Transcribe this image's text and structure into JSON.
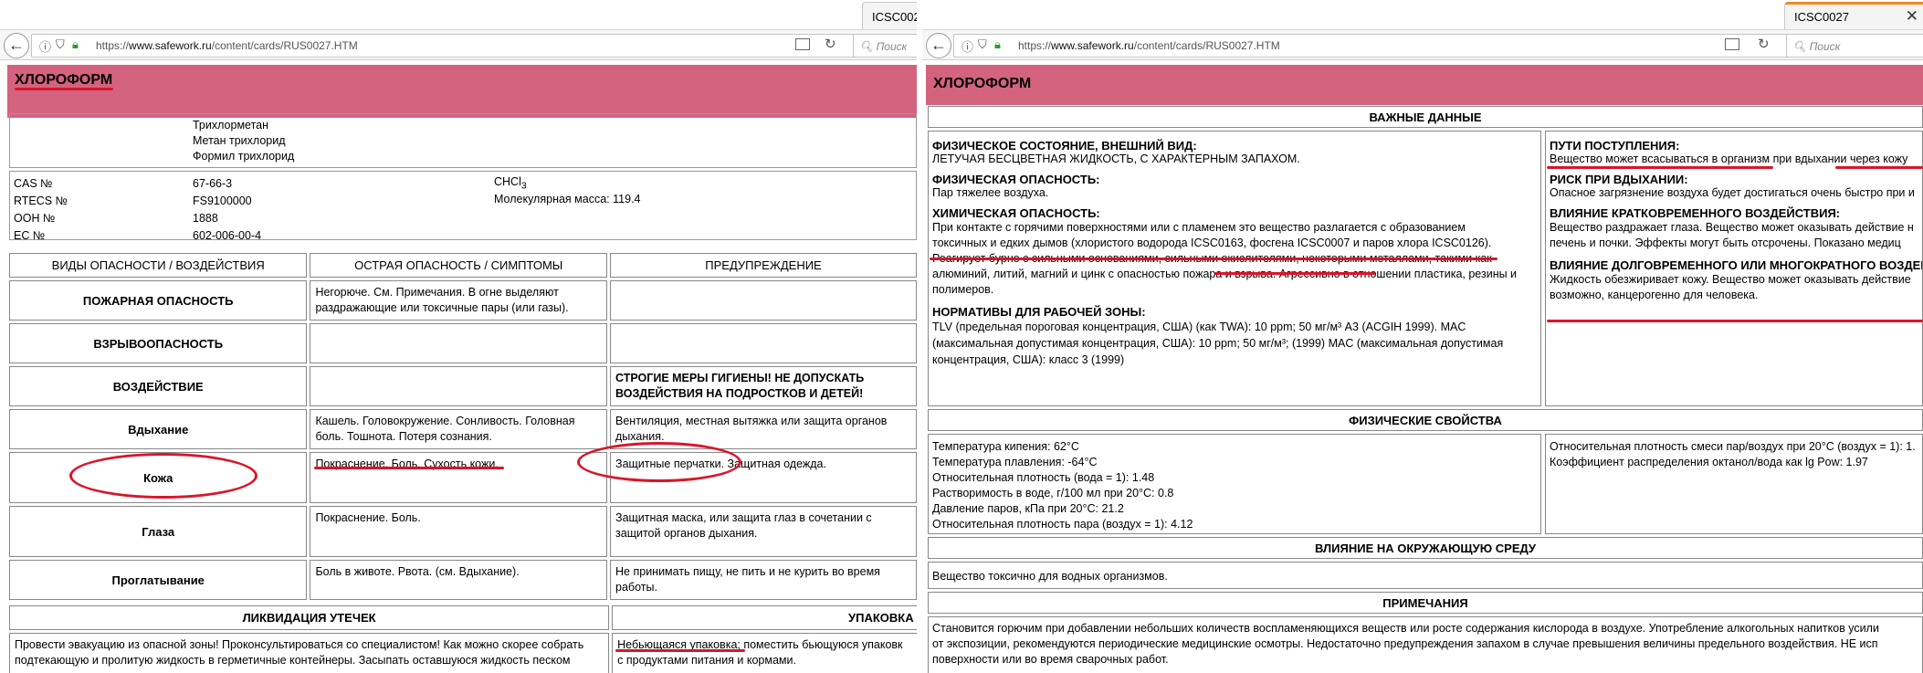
{
  "browser": {
    "tab_title": "ICSC0027",
    "url_host": "www.safework.ru",
    "url_scheme": "https://",
    "url_path": "/content/cards/RUS0027.HTM",
    "search_placeholder": "Поиск",
    "back_glyph": "←"
  },
  "card": {
    "title": "ХЛОРОФОРМ",
    "synonyms": [
      "Трихлорметан",
      "Метан трихлорид",
      "Формил трихлорид"
    ],
    "ids": [
      {
        "label": "CAS №",
        "value": "67-66-3"
      },
      {
        "label": "RTECS №",
        "value": "FS9100000"
      },
      {
        "label": "ООН №",
        "value": "1888"
      },
      {
        "label": "ЕС №",
        "value": "602-006-00-4"
      }
    ],
    "formula": "CHCl",
    "formula_sub": "3",
    "mol_mass_label": "Молекулярная масса:",
    "mol_mass_value": "119.4",
    "hazards_table": {
      "headers": [
        "ВИДЫ ОПАСНОСТИ / ВОЗДЕЙСТВИЯ",
        "ОСТРАЯ ОПАСНОСТЬ / СИМПТОМЫ",
        "ПРЕДУПРЕЖДЕНИЕ"
      ],
      "fire": {
        "label": "ПОЖАРНАЯ ОПАСНОСТЬ",
        "symptoms": "Негорюче. См. Примечания. В огне выделяют раздражающие или токсичные пары (или газы).",
        "prevention": ""
      },
      "explosion": {
        "label": "ВЗРЫВООПАСНОСТЬ",
        "symptoms": "",
        "prevention": ""
      },
      "exposure": {
        "label": "ВОЗДЕЙСТВИЕ",
        "symptoms": "",
        "prevention": "СТРОГИЕ МЕРЫ ГИГИЕНЫ! НЕ ДОПУСКАТЬ ВОЗДЕЙСТВИЯ НА ПОДРОСТКОВ И ДЕТЕЙ!"
      },
      "inhalation": {
        "label": "Вдыхание",
        "symptoms": "Кашель. Головокружение. Сонливость. Головная боль. Тошнота. Потеря сознания.",
        "prevention": "Вентиляция, местная вытяжка или защита органов дыхания."
      },
      "skin": {
        "label": "Кожа",
        "symptoms": "Покраснение. Боль. Сухость кожи.",
        "prevention": "Защитные перчатки. Защитная одежда."
      },
      "eyes": {
        "label": "Глаза",
        "symptoms": "Покраснение. Боль.",
        "prevention": "Защитная маска, или защита глаз в сочетании с защитой органов дыхания."
      },
      "ingestion": {
        "label": "Проглатывание",
        "symptoms": "Боль в животе. Рвота. (см. Вдыхание).",
        "prevention": "Не принимать пищу, не пить и не курить во время работы."
      }
    },
    "spill": {
      "header": "ЛИКВИДАЦИЯ УТЕЧЕК",
      "text": "Провести эвакуацию из опасной зоны! Проконсультироваться со специалистом! Как можно скорее собрать подтекающую и пролитую жидкость в герметичные контейнеры. Засыпать оставшуюся жидкость песком"
    },
    "packaging": {
      "header": "УПАКОВКА И М",
      "text_underlined": "Небьющаяся упаковка",
      "text_rest": "; поместить бьющуюся упаковк",
      "text_line2": "с продуктами питания и кормами."
    }
  },
  "right": {
    "important_header": "ВАЖНЫЕ ДАННЫЕ",
    "phys_state_title": "ФИЗИЧЕСКОЕ СОСТОЯНИЕ, ВНЕШНИЙ ВИД:",
    "phys_state_text": "ЛЕТУЧАЯ БЕСЦВЕТНАЯ ЖИДКОСТЬ, С ХАРАКТЕРНЫМ ЗАПАХОМ.",
    "phys_hazard_title": "ФИЗИЧЕСКАЯ ОПАСНОСТЬ:",
    "phys_hazard_text": "Пар тяжелее воздуха.",
    "chem_hazard_title": "ХИМИЧЕСКАЯ ОПАСНОСТЬ:",
    "chem_hazard_line1": "При контакте с горячими поверхностями или с пламенем это вещество разлагается с образованием",
    "chem_hazard_line2a": "токсичных и едких дымов (хлористого водорода ICSC0163, ",
    "chem_hazard_phosgene": "фосгена ICSC0007",
    "chem_hazard_line2b": " и паров хлора ICSC0126).",
    "chem_hazard_rest": "Реагирует бурно с сильными основаниями, сильными окислителями, некоторыми металлами, такими как алюминий, литий, магний и цинк с опасностью пожара и взрыва. Агрессивно в отношении пластика, резины и полимеров.",
    "norms_title": "НОРМАТИВЫ ДЛЯ РАБОЧЕЙ ЗОНЫ:",
    "norms_text": "TLV (предельная пороговая концентрация, США) (как TWA): 10 ppm; 50 мг/м³ A3 (ACGIH 1999). MAC (максимальная допустимая концентрация, США): 10 ppm; 50 мг/м³; (1999) MAC (максимальная допустимая концентрация, США): класс 3 (1999)",
    "routes_title": "ПУТИ ПОСТУПЛЕНИЯ:",
    "routes_text_u1": "Вещество может всасываться в организм",
    "routes_text_mid": " при вдыхании ",
    "routes_text_u2": "через кожу",
    "inhal_risk_title": "РИСК ПРИ ВДЫХАНИИ:",
    "inhal_risk_text": "Опасное загрязнение воздуха будет достигаться очень быстро при и",
    "short_term_title": "ВЛИЯНИЕ КРАТКОВРЕМЕННОГО ВОЗДЕЙСТВИЯ:",
    "short_term_text1": "Вещество раздражает глаза. Вещество может оказывать действие н",
    "short_term_text2": "печень и почки. Эффекты могут быть отсрочены. Показано медиц",
    "long_term_title": "ВЛИЯНИЕ ДОЛГОВРЕМЕННОГО ИЛИ МНОГОКРАТНОГО ВОЗДЕЙС",
    "long_term_text1": "Жидкость обезжиривает кожу. Вещество может оказывать действие",
    "long_term_text2": "возможно, канцерогенно для человека.",
    "phys_props_header": "ФИЗИЧЕСКИЕ СВОЙСТВА",
    "phys_props_left": [
      "Температура кипения: 62°C",
      "Температура плавления: -64°C",
      "Относительная плотность (вода = 1): 1.48",
      "Растворимость в воде, г/100 мл при 20°C: 0.8",
      "Давление паров, кПа при 20°C: 21.2",
      "Относительная плотность пара (воздух = 1): 4.12"
    ],
    "phys_props_right": [
      "Относительная плотность смеси пар/воздух при 20°C (воздух = 1): 1.",
      "Коэффициент распределения октанол/вода как lg Pow: 1.97"
    ],
    "env_header": "ВЛИЯНИЕ НА ОКРУЖАЮЩУЮ СРЕДУ",
    "env_text": "Вещество токсично для водных организмов.",
    "notes_header": "ПРИМЕЧАНИЯ",
    "notes_text1": "Становится горючим при добавлении небольших количеств воспламеняющихся веществ или росте содержания кислорода в воздухе. Употребление алкогольных напитков усили",
    "notes_text2": "от экспозиции, рекомендуются периодические медицинские осмотры. Недостаточно предупреждения запахом в случае превышения величины предельного воздействия. НЕ исп",
    "notes_text3": "поверхности или во время сварочных работ."
  },
  "colors": {
    "title_bar": "#d3637f",
    "annotation": "#d8162b",
    "tab_accent": "#f08a24"
  }
}
